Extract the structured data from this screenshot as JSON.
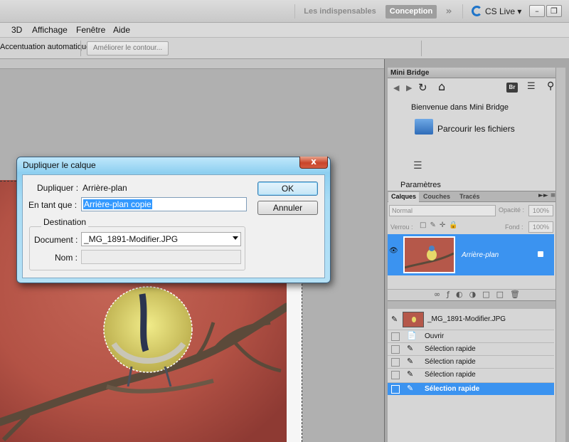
{
  "topbar": {
    "workspace_essentials": "Les indispensables",
    "workspace_design": "Conception",
    "more": "»",
    "cs_live": "CS Live ▾"
  },
  "menu": {
    "items": [
      "3D",
      "Affichage",
      "Fenêtre",
      "Aide"
    ]
  },
  "options": {
    "auto_enhance": "Accentuation automatique",
    "refine_edge": "Améliorer le contour..."
  },
  "mini_bridge": {
    "title": "Mini Bridge",
    "welcome": "Bienvenue dans Mini Bridge",
    "browse": "Parcourir les fichiers",
    "params": "Paramètres"
  },
  "layers": {
    "tabs": [
      "Calques",
      "Couches",
      "Tracés"
    ],
    "blend_mode": "Normal",
    "opacity_label": "Opacité :",
    "opacity": "100%",
    "lock_label": "Verrou :",
    "fill_label": "Fond :",
    "fill": "100%",
    "layer_name": "Arrière-plan"
  },
  "history": {
    "snapshot": "_MG_1891-Modifier.JPG",
    "items": [
      "Ouvrir",
      "Sélection rapide",
      "Sélection rapide",
      "Sélection rapide",
      "Sélection rapide"
    ]
  },
  "dialog": {
    "title": "Dupliquer le calque",
    "close": "x",
    "duplicate_label": "Dupliquer :",
    "duplicate_value": "Arrière-plan",
    "as_label": "En tant que :",
    "as_value": "Arrière-plan copie",
    "destination": "Destination",
    "document_label": "Document :",
    "document_value": "_MG_1891-Modifier.JPG",
    "name_label": "Nom :",
    "ok": "OK",
    "cancel": "Annuler"
  },
  "colors": {
    "selection_blue": "#3b93f0",
    "photo_background": "#b5584a",
    "dialog_glass": "#a9dcf5"
  }
}
